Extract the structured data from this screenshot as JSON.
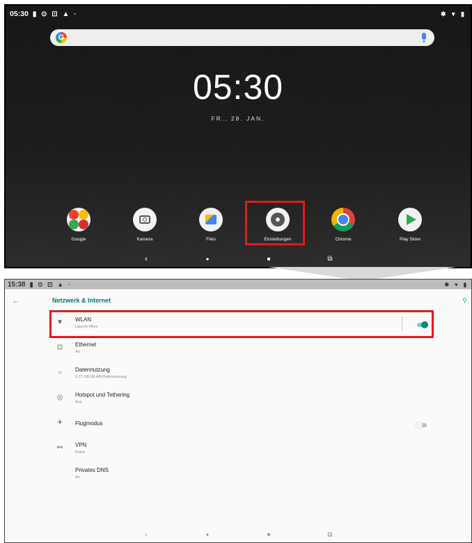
{
  "home": {
    "status_time": "05:30",
    "status_icons": "▮ ⊙ ⊡ ▲ ·",
    "status_right": "✱ ▾ ▮",
    "clock": "05:30",
    "date": "FR., 28. JAN.",
    "search_logo": "G",
    "apps": [
      {
        "label": "Google"
      },
      {
        "label": "Kamera"
      },
      {
        "label": "Files"
      },
      {
        "label": "Einstellungen"
      },
      {
        "label": "Chrome"
      },
      {
        "label": "Play Store"
      }
    ],
    "nav": {
      "back": "‹",
      "home": "●",
      "recents": "■",
      "extra": "⧉"
    }
  },
  "settings": {
    "status_time": "15:38",
    "status_icons": "▮ ⊙ ⊡ ▲ ·",
    "status_right": "✱ ▾ ▮",
    "back_icon": "←",
    "title": "Netzwerk & Internet",
    "search_icon": "⚲",
    "items": [
      {
        "icon": "wifi-icon",
        "glyph": "▼",
        "title": "WLAN",
        "subtitle": "Launch-Wkst",
        "toggle": true
      },
      {
        "icon": "ethernet-icon",
        "glyph": "⊡",
        "title": "Ethernet",
        "subtitle": "An"
      },
      {
        "icon": "data-usage-icon",
        "glyph": "○",
        "title": "Datennutzung",
        "subtitle": "3,77 GB WLAN-Datennutzung"
      },
      {
        "icon": "hotspot-icon",
        "glyph": "◎",
        "title": "Hotspot und Tethering",
        "subtitle": "Aus"
      },
      {
        "icon": "airplane-icon",
        "glyph": "✈",
        "title": "Flugmodus",
        "subtitle": "",
        "toggle": false
      },
      {
        "icon": "vpn-icon",
        "glyph": "⚯",
        "title": "VPN",
        "subtitle": "Keine"
      },
      {
        "icon": "",
        "glyph": "",
        "title": "Privates DNS",
        "subtitle": "An"
      }
    ],
    "nav": {
      "back": "‹",
      "home": "●",
      "recents": "■",
      "extra": "⧉"
    }
  },
  "colors": {
    "accent": "#00897b",
    "highlight": "#e01b22"
  }
}
